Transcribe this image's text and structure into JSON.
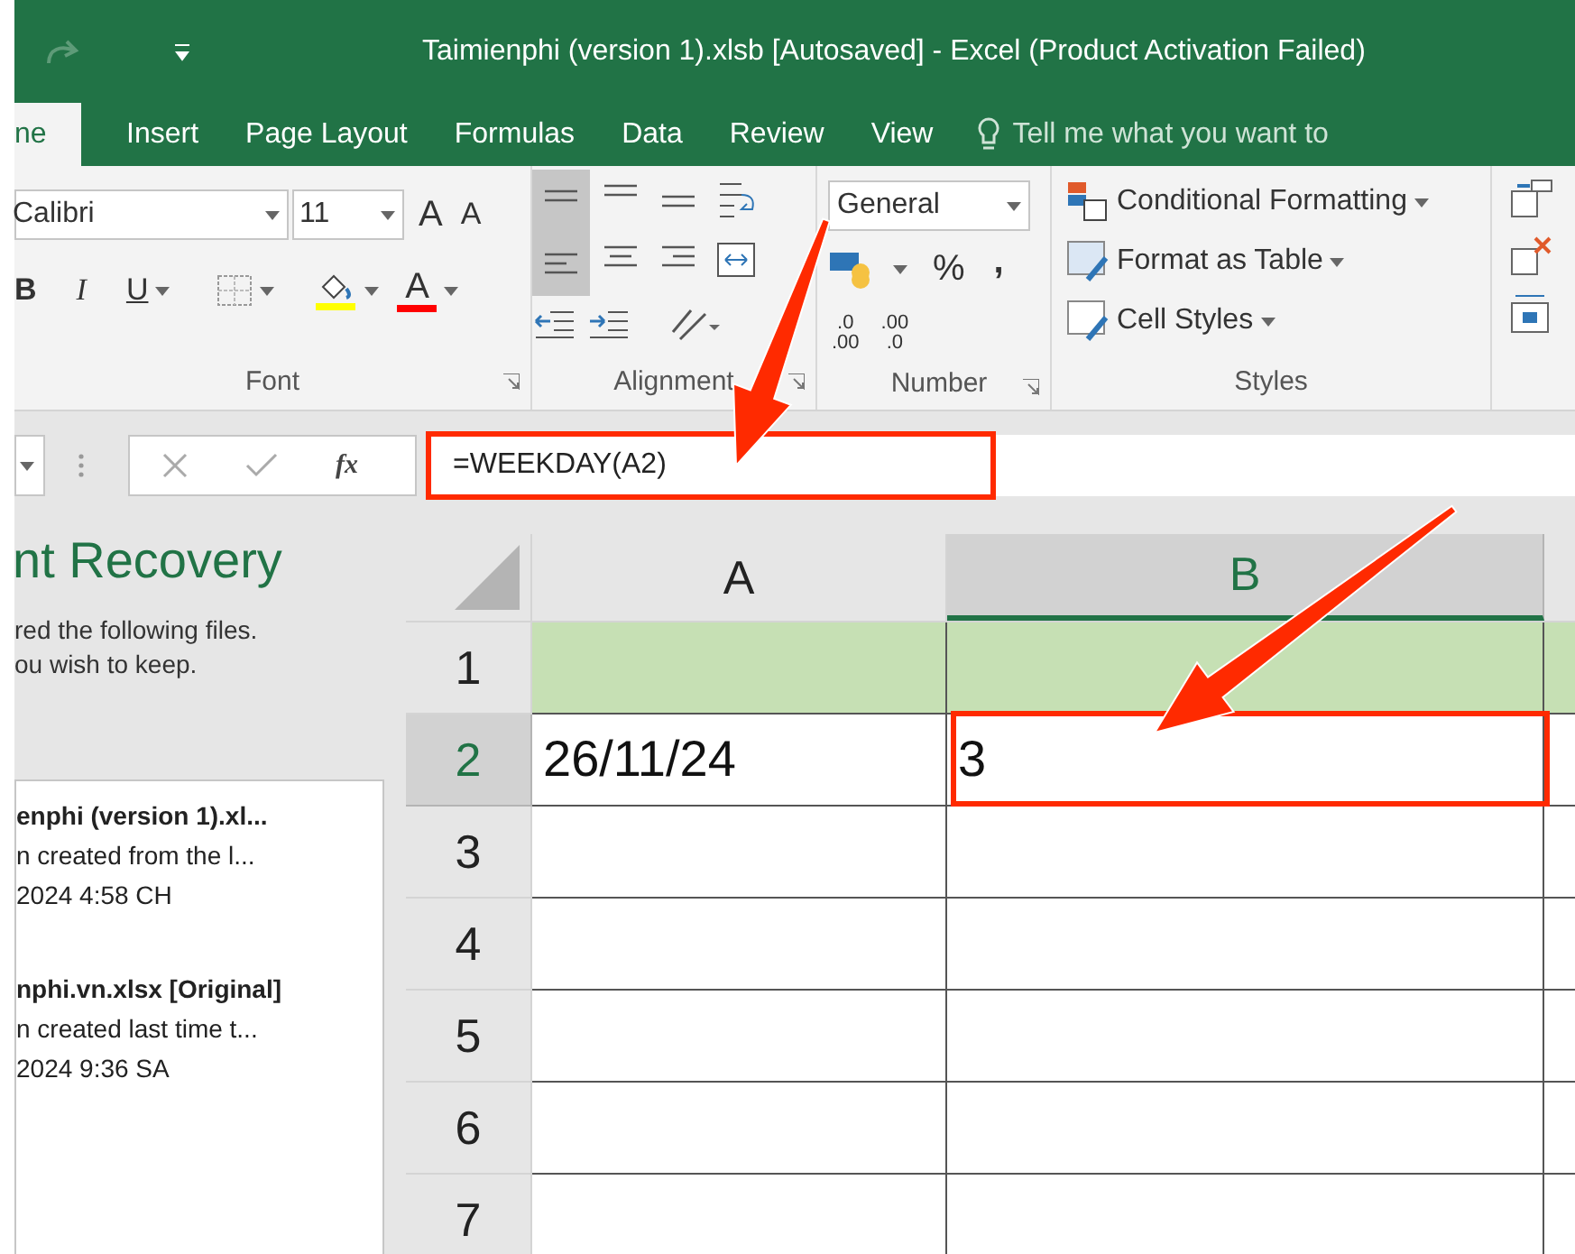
{
  "window": {
    "title": "Taimienphi (version 1).xlsb [Autosaved] - Excel (Product Activation Failed)"
  },
  "tabs": [
    {
      "label": "ne",
      "selected": true
    },
    {
      "label": "Insert",
      "selected": false
    },
    {
      "label": "Page Layout",
      "selected": false
    },
    {
      "label": "Formulas",
      "selected": false
    },
    {
      "label": "Data",
      "selected": false
    },
    {
      "label": "Review",
      "selected": false
    },
    {
      "label": "View",
      "selected": false
    }
  ],
  "tell_me": {
    "placeholder": "Tell me what you want to"
  },
  "ribbon": {
    "font": {
      "font_name": "Calibri",
      "font_size": "11",
      "grow": "A",
      "shrink": "A",
      "styles": [
        "B",
        "I",
        "U"
      ],
      "font_color": "A",
      "label": "Font"
    },
    "alignment": {
      "label": "Alignment"
    },
    "number": {
      "format": "General",
      "percent": "%",
      "comma": ",",
      "decimals": [
        {
          "top": ".0",
          "bottom": ".00"
        },
        {
          "top": ".00",
          "bottom": ".0"
        }
      ],
      "label": "Number"
    },
    "styles": {
      "items": [
        "Conditional Formatting",
        "Format as Table",
        "Cell Styles"
      ],
      "label": "Styles"
    }
  },
  "formula_bar": {
    "fx": "fx",
    "value": "=WEEKDAY(A2)",
    "highlighted": true
  },
  "recovery_pane": {
    "title": "nt Recovery",
    "lines": [
      "red the following files.",
      "ou wish to keep."
    ],
    "files": [
      {
        "name": "enphi (version 1).xl...",
        "detail": "n created from the l...",
        "time": "2024 4:58 CH"
      },
      {
        "name": "nphi.vn.xlsx  [Original]",
        "detail": "n created last time t...",
        "time": "2024 9:36 SA"
      }
    ]
  },
  "sheet": {
    "columns": [
      {
        "label": "A",
        "selected": false
      },
      {
        "label": "B",
        "selected": true
      }
    ],
    "rows": [
      {
        "label": "1",
        "selected": false,
        "filled": true
      },
      {
        "label": "2",
        "selected": true,
        "filled": false,
        "cells": [
          {
            "value": "26/11/24",
            "highlighted": false
          },
          {
            "value": "3",
            "highlighted": true
          }
        ]
      },
      {
        "label": "3",
        "selected": false,
        "filled": false
      },
      {
        "label": "4",
        "selected": false,
        "filled": false
      },
      {
        "label": "5",
        "selected": false,
        "filled": false
      },
      {
        "label": "6",
        "selected": false,
        "filled": false
      },
      {
        "label": "7",
        "selected": false,
        "filled": false
      }
    ]
  }
}
